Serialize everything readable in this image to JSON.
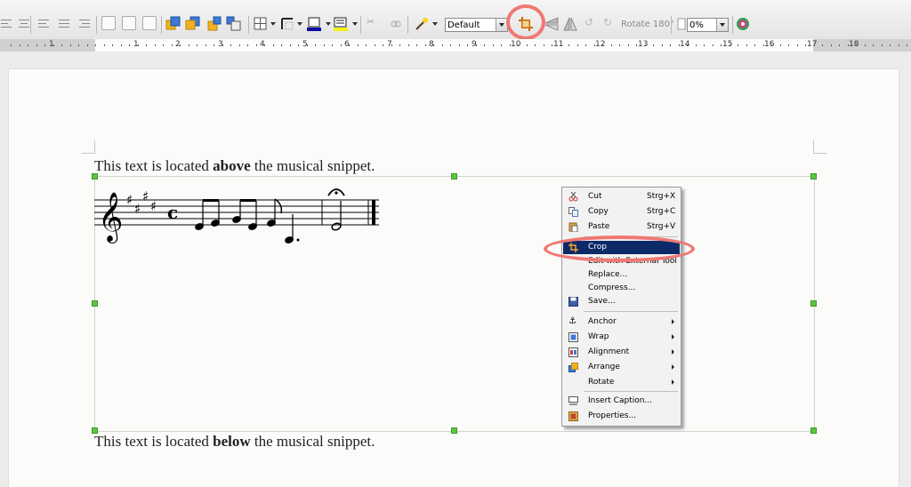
{
  "toolbar": {
    "style_combo_value": "Default",
    "rotate_label": "Rotate 180°",
    "transparency_value": "0%"
  },
  "ruler": {
    "numbers": [
      "1",
      "1",
      "2",
      "3",
      "4",
      "5",
      "6",
      "7",
      "8",
      "9",
      "10",
      "11",
      "12",
      "13",
      "14",
      "15",
      "16",
      "17",
      "18"
    ]
  },
  "document": {
    "para_above": {
      "before": "This text is located ",
      "bold": "above",
      "after": " the musical snippet."
    },
    "para_below": {
      "before": "This text is located ",
      "bold": "below",
      "after": " the musical snippet."
    }
  },
  "context_menu": {
    "items": [
      {
        "label": "Cut",
        "shortcut": "Strg+X",
        "icon": "scissors-icon"
      },
      {
        "label": "Copy",
        "shortcut": "Strg+C",
        "icon": "copy-icon"
      },
      {
        "label": "Paste",
        "shortcut": "Strg+V",
        "icon": "paste-icon"
      },
      {
        "label": "Crop",
        "icon": "crop-icon",
        "selected": true
      },
      {
        "label": "Edit with External Tool"
      },
      {
        "label": "Replace..."
      },
      {
        "label": "Compress..."
      },
      {
        "label": "Save...",
        "icon": "save-icon"
      },
      {
        "label": "Anchor",
        "icon": "anchor-icon",
        "submenu": true
      },
      {
        "label": "Wrap",
        "icon": "wrap-icon",
        "submenu": true
      },
      {
        "label": "Alignment",
        "icon": "alignment-icon",
        "submenu": true
      },
      {
        "label": "Arrange",
        "icon": "arrange-icon",
        "submenu": true
      },
      {
        "label": "Rotate",
        "submenu": true
      },
      {
        "label": "Insert Caption...",
        "icon": "caption-icon"
      },
      {
        "label": "Properties...",
        "icon": "properties-icon"
      }
    ]
  },
  "colors": {
    "highlight_ring": "#ef7873",
    "menu_selected": "#0c2a68",
    "handle": "#5bc641"
  }
}
